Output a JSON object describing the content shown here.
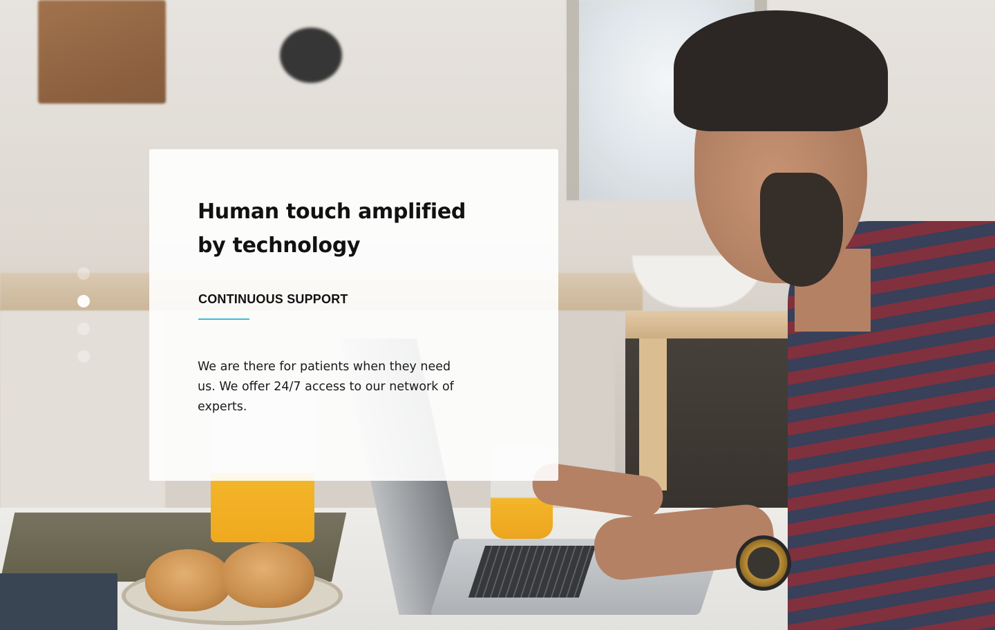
{
  "background": {
    "image_alt": "Man with laptop at a kitchen table with croissants and orange juice"
  },
  "slider": {
    "dots": [
      {
        "active": false
      },
      {
        "active": true
      },
      {
        "active": false
      },
      {
        "active": false
      }
    ]
  },
  "card": {
    "title": "Human touch amplified by technology",
    "eyebrow": "CONTINUOUS SUPPORT",
    "body": "We are there for patients when they need us. We offer 24/7 access to our network of experts.",
    "accent_color": "#3fbcd6"
  }
}
